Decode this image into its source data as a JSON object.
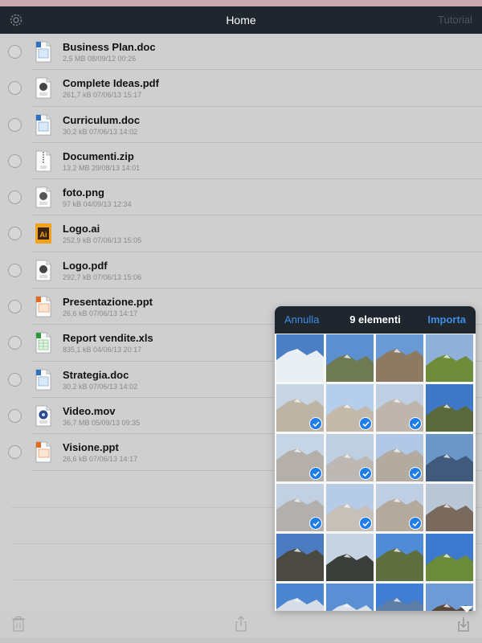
{
  "navbar": {
    "title": "Home",
    "right_label": "Tutorial",
    "settings_icon": "gear-icon"
  },
  "files": [
    {
      "name": "Business Plan.doc",
      "meta": "2,5 MB 08/09/12 00:26",
      "type": "doc"
    },
    {
      "name": "Complete Ideas.pdf",
      "meta": "261,7 kB 07/06/13 15:17",
      "type": "pdf"
    },
    {
      "name": "Curriculum.doc",
      "meta": "30,2 kB 07/06/13 14:02",
      "type": "doc"
    },
    {
      "name": "Documenti.zip",
      "meta": "13,2 MB 29/08/13 14:01",
      "type": "zip"
    },
    {
      "name": "foto.png",
      "meta": "97 kB 04/09/13 12:34",
      "type": "png"
    },
    {
      "name": "Logo.ai",
      "meta": "252,9 kB 07/06/13 15:05",
      "type": "ai"
    },
    {
      "name": "Logo.pdf",
      "meta": "292,7 kB 07/06/13 15:06",
      "type": "pdf"
    },
    {
      "name": "Presentazione.ppt",
      "meta": "26,6 kB 07/06/13 14:17",
      "type": "ppt"
    },
    {
      "name": "Report vendite.xls",
      "meta": "835,1 kB 04/06/13 20:17",
      "type": "xls"
    },
    {
      "name": "Strategia.doc",
      "meta": "30,2 kB 07/06/13 14:02",
      "type": "doc"
    },
    {
      "name": "Video.mov",
      "meta": "36,7 MB 05/09/13 09:35",
      "type": "mov"
    },
    {
      "name": "Visione.ppt",
      "meta": "26,6 kB 07/06/13 14:17",
      "type": "ppt"
    }
  ],
  "toolbar": {
    "trash_icon": "trash-icon",
    "share_icon": "share-icon",
    "import_icon": "import-icon"
  },
  "picker": {
    "cancel_label": "Annulla",
    "title": "9 elementi",
    "import_label": "Importa",
    "photos": [
      {
        "id": 1,
        "selected": false,
        "sky": "#4a7fc4",
        "ground": "#e9eef3"
      },
      {
        "id": 2,
        "selected": false,
        "sky": "#5c8fd0",
        "ground": "#6d7a52"
      },
      {
        "id": 3,
        "selected": false,
        "sky": "#6a9ad6",
        "ground": "#8c7a62"
      },
      {
        "id": 4,
        "selected": false,
        "sky": "#8fb0d8",
        "ground": "#6f8c3a"
      },
      {
        "id": 5,
        "selected": true,
        "sky": "#a9bdd4",
        "ground": "#9c8d76"
      },
      {
        "id": 6,
        "selected": true,
        "sky": "#8db4e2",
        "ground": "#a59580"
      },
      {
        "id": 7,
        "selected": true,
        "sky": "#9bb6d6",
        "ground": "#9b8f80"
      },
      {
        "id": 8,
        "selected": false,
        "sky": "#3f78c7",
        "ground": "#5b6a3c"
      },
      {
        "id": 9,
        "selected": true,
        "sky": "#a7bfd9",
        "ground": "#8d857a"
      },
      {
        "id": 10,
        "selected": true,
        "sky": "#9cb5d3",
        "ground": "#9a928a"
      },
      {
        "id": 11,
        "selected": true,
        "sky": "#86abd8",
        "ground": "#8c7f6d"
      },
      {
        "id": 12,
        "selected": false,
        "sky": "#6b96c8",
        "ground": "#3f5a7a"
      },
      {
        "id": 13,
        "selected": true,
        "sky": "#a2b8d2",
        "ground": "#8a8580"
      },
      {
        "id": 14,
        "selected": true,
        "sky": "#8fb0d9",
        "ground": "#a89f92"
      },
      {
        "id": 15,
        "selected": true,
        "sky": "#9bb5d5",
        "ground": "#8b7b68"
      },
      {
        "id": 16,
        "selected": false,
        "sky": "#b9c6d6",
        "ground": "#7a6a5d"
      },
      {
        "id": 17,
        "selected": false,
        "sky": "#4b7cc2",
        "ground": "#4a4a42"
      },
      {
        "id": 18,
        "selected": false,
        "sky": "#c6d3e3",
        "ground": "#3b3f3c"
      },
      {
        "id": 19,
        "selected": false,
        "sky": "#4f8bd6",
        "ground": "#5f6e3f"
      },
      {
        "id": 20,
        "selected": false,
        "sky": "#3c79cf",
        "ground": "#6b8a3a"
      },
      {
        "id": 21,
        "selected": false,
        "sky": "#4d86d0",
        "ground": "#d7dde6"
      },
      {
        "id": 22,
        "selected": false,
        "sky": "#5b8fd3",
        "ground": "#dce2ea"
      },
      {
        "id": 23,
        "selected": false,
        "sky": "#3f7ed4",
        "ground": "#5c7ea7"
      },
      {
        "id": 24,
        "selected": false,
        "sky": "#6e9bd5",
        "ground": "#58483b"
      }
    ]
  },
  "colors": {
    "navbar_bg": "#1f262d",
    "accent": "#3d8ce6",
    "check": "#1e7de8"
  }
}
